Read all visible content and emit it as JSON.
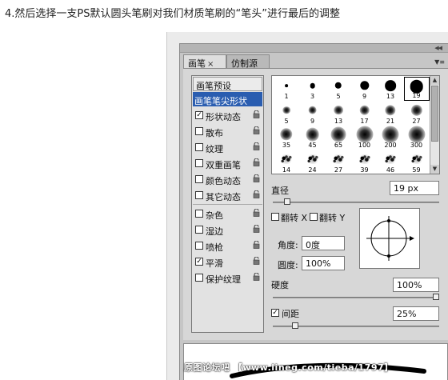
{
  "instruction": "4.然后选择一支PS默认圆头笔刷对我们材质笔刷的“笔头”进行最后的调整",
  "tabs": [
    {
      "label": "画笔",
      "close": "×"
    },
    {
      "label": "仿制源"
    }
  ],
  "preset_button": "画笔预设",
  "brush_options": [
    {
      "label": "画笔笔尖形状",
      "checked": null,
      "selected": true,
      "lock": false
    },
    {
      "label": "形状动态",
      "checked": true,
      "selected": false,
      "lock": true
    },
    {
      "label": "散布",
      "checked": false,
      "selected": false,
      "lock": true
    },
    {
      "label": "纹理",
      "checked": false,
      "selected": false,
      "lock": true
    },
    {
      "label": "双重画笔",
      "checked": false,
      "selected": false,
      "lock": true
    },
    {
      "label": "颜色动态",
      "checked": false,
      "selected": false,
      "lock": true
    },
    {
      "label": "其它动态",
      "checked": false,
      "selected": false,
      "lock": true
    },
    {
      "label": "杂色",
      "checked": false,
      "selected": false,
      "lock": true
    },
    {
      "label": "湿边",
      "checked": false,
      "selected": false,
      "lock": true
    },
    {
      "label": "喷枪",
      "checked": false,
      "selected": false,
      "lock": true
    },
    {
      "label": "平滑",
      "checked": true,
      "selected": false,
      "lock": true
    },
    {
      "label": "保护纹理",
      "checked": false,
      "selected": false,
      "lock": true
    }
  ],
  "brush_tips": [
    {
      "size": "1",
      "type": "hard"
    },
    {
      "size": "3",
      "type": "hard"
    },
    {
      "size": "5",
      "type": "hard"
    },
    {
      "size": "9",
      "type": "hard"
    },
    {
      "size": "13",
      "type": "hard"
    },
    {
      "size": "19",
      "type": "hard",
      "selected": true
    },
    {
      "size": "5",
      "type": "soft"
    },
    {
      "size": "9",
      "type": "soft"
    },
    {
      "size": "13",
      "type": "soft"
    },
    {
      "size": "17",
      "type": "soft"
    },
    {
      "size": "21",
      "type": "soft"
    },
    {
      "size": "27",
      "type": "soft"
    },
    {
      "size": "35",
      "type": "soft"
    },
    {
      "size": "45",
      "type": "soft"
    },
    {
      "size": "65",
      "type": "soft"
    },
    {
      "size": "100",
      "type": "soft"
    },
    {
      "size": "200",
      "type": "soft"
    },
    {
      "size": "300",
      "type": "soft"
    },
    {
      "size": "14",
      "type": "spatter"
    },
    {
      "size": "24",
      "type": "spatter"
    },
    {
      "size": "27",
      "type": "spatter"
    },
    {
      "size": "39",
      "type": "spatter"
    },
    {
      "size": "46",
      "type": "spatter"
    },
    {
      "size": "59",
      "type": "spatter"
    }
  ],
  "diameter": {
    "label": "直径",
    "value": "19 px",
    "slider_fraction": 0.07
  },
  "flip_x": {
    "label": "翻转 X",
    "checked": false
  },
  "flip_y": {
    "label": "翻转 Y",
    "checked": false
  },
  "angle": {
    "label": "角度:",
    "value": "0度"
  },
  "roundness": {
    "label": "圆度:",
    "value": "100%"
  },
  "hardness": {
    "label": "硬度",
    "value": "100%",
    "slider_fraction": 1.0
  },
  "spacing": {
    "label": "间距",
    "checked": true,
    "value": "25%",
    "slider_fraction": 0.12
  },
  "watermark": "原图论坛吧 【www.lineg.com/tieba/1797】",
  "colors": {
    "selection": "#2a5db0",
    "panel": "#c6c6c6"
  }
}
